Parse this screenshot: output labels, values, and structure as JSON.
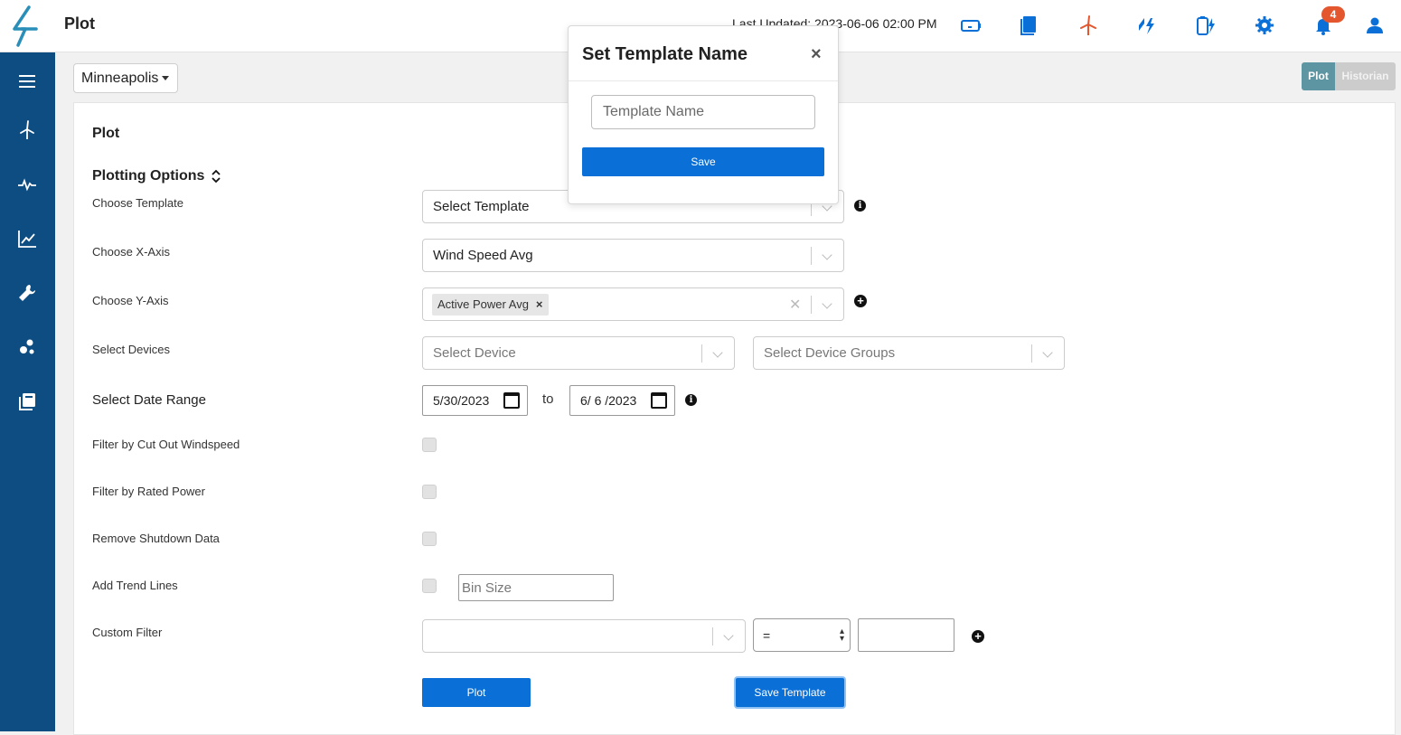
{
  "header": {
    "title": "Plot",
    "last_updated": "Last Updated: 2023-06-06 02:00 PM",
    "notification_count": "4",
    "accent": "#0a6fd6",
    "turbine_color": "#e4572e"
  },
  "site_selector": {
    "value": "Minneapolis"
  },
  "view_toggle": {
    "plot": "Plot",
    "historian": "Historian"
  },
  "card": {
    "title": "Plot",
    "section_title": "Plotting Options"
  },
  "form": {
    "choose_template": {
      "label": "Choose Template",
      "placeholder": "Select Template"
    },
    "choose_x_axis": {
      "label": "Choose X-Axis",
      "value": "Wind Speed Avg"
    },
    "choose_y_axis": {
      "label": "Choose Y-Axis",
      "chip": "Active Power Avg"
    },
    "select_devices": {
      "label": "Select Devices",
      "device_placeholder": "Select Device",
      "group_placeholder": "Select Device Groups"
    },
    "date_range": {
      "label": "Select Date Range",
      "start": "5/30/2023",
      "to": "to",
      "end": "6/ 6 /2023"
    },
    "filter_cut_out": {
      "label": "Filter by Cut Out Windspeed"
    },
    "filter_rated_power": {
      "label": "Filter by Rated Power"
    },
    "remove_shutdown": {
      "label": "Remove Shutdown Data"
    },
    "add_trend_lines": {
      "label": "Add Trend Lines",
      "bin_size_placeholder": "Bin Size"
    },
    "custom_filter": {
      "label": "Custom Filter",
      "operator": "="
    }
  },
  "buttons": {
    "plot": "Plot",
    "save_template": "Save Template"
  },
  "modal": {
    "title": "Set Template Name",
    "close": "×",
    "input_placeholder": "Template Name",
    "save": "Save"
  }
}
